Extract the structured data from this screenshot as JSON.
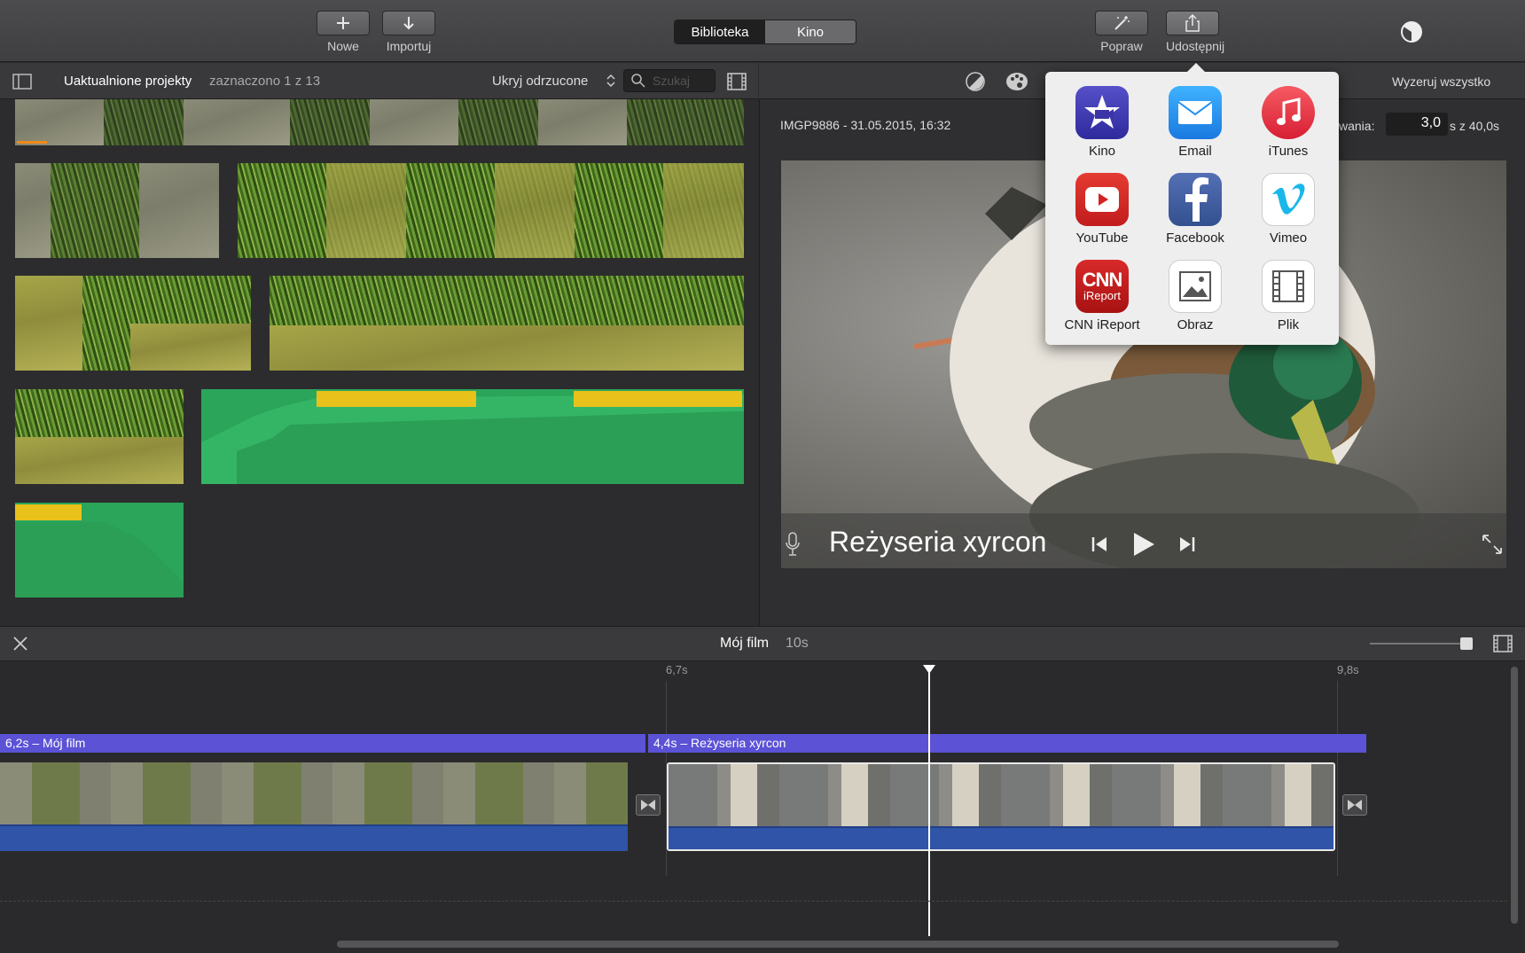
{
  "toolbar": {
    "new_label": "Nowe",
    "import_label": "Importuj",
    "library_tab": "Biblioteka",
    "theater_tab": "Kino",
    "enhance_label": "Popraw",
    "share_label": "Udostępnij"
  },
  "library": {
    "title": "Uaktualnione projekty",
    "selection": "zaznaczono 1 z 13",
    "filter": "Ukryj odrzucone",
    "search_placeholder": "Szukaj"
  },
  "viewer": {
    "reset_label": "Wyzeruj wszystko",
    "clip_info": "IMGP9886 - 31.05.2015, 16:32",
    "duration_label": "wania:",
    "duration_value": "3,0",
    "duration_total": "s z 40,0s",
    "title_overlay": "Reżyseria xyrcon"
  },
  "share_menu": {
    "items": [
      {
        "label": "Kino",
        "icon": "theater-icon",
        "color": "#3b35a8"
      },
      {
        "label": "Email",
        "icon": "mail-icon",
        "color": "#1f8ff0"
      },
      {
        "label": "iTunes",
        "icon": "itunes-icon",
        "color": "#e8303f"
      },
      {
        "label": "YouTube",
        "icon": "youtube-icon",
        "color": "#d42222"
      },
      {
        "label": "Facebook",
        "icon": "facebook-icon",
        "color": "#3b5ca0"
      },
      {
        "label": "Vimeo",
        "icon": "vimeo-icon",
        "color": "#1ab7ea"
      },
      {
        "label": "CNN iReport",
        "icon": "cnn-ireport-icon",
        "color": "#c31a1a"
      },
      {
        "label": "Obraz",
        "icon": "image-icon",
        "color": "#ffffff"
      },
      {
        "label": "Plik",
        "icon": "file-icon",
        "color": "#ffffff"
      }
    ],
    "cnn_text": "CNN",
    "ireport_text": "iReport"
  },
  "timeline": {
    "project_name": "Mój film",
    "project_duration": "10s",
    "ruler_mark_1": "6,7s",
    "ruler_mark_2": "9,8s",
    "clip1_title": "6,2s – Mój film",
    "clip2_title": "4,4s –  Reżyseria xyrcon"
  },
  "colors": {
    "accent_purple": "#5b52d6",
    "audio_blue": "#2f54a8",
    "audio_green": "#2aa55a"
  }
}
